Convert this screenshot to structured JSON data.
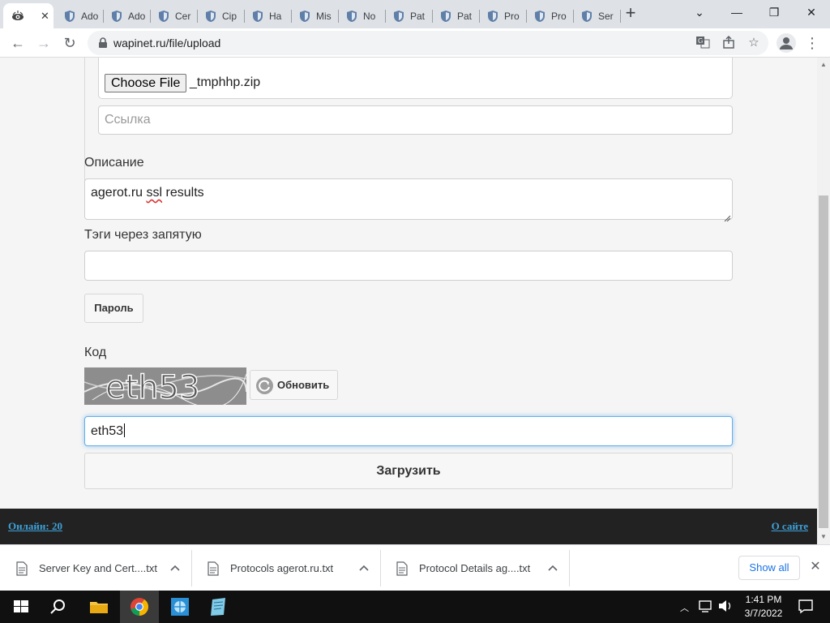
{
  "browser": {
    "tabs": [
      {
        "title": "",
        "icon": "eye-favicon",
        "active": true
      },
      {
        "title": "Ado",
        "icon": "shield-favicon"
      },
      {
        "title": "Ado",
        "icon": "shield-favicon"
      },
      {
        "title": "Cer",
        "icon": "shield-favicon"
      },
      {
        "title": "Cip",
        "icon": "shield-favicon"
      },
      {
        "title": "Ha",
        "icon": "shield-favicon"
      },
      {
        "title": "Mis",
        "icon": "shield-favicon"
      },
      {
        "title": "No",
        "icon": "shield-favicon"
      },
      {
        "title": "Pat",
        "icon": "shield-favicon"
      },
      {
        "title": "Pat",
        "icon": "shield-favicon"
      },
      {
        "title": "Pro",
        "icon": "shield-favicon"
      },
      {
        "title": "Pro",
        "icon": "shield-favicon"
      },
      {
        "title": "Ser",
        "icon": "shield-favicon"
      }
    ],
    "url": "wapinet.ru/file/upload"
  },
  "form": {
    "file_button": "Choose File",
    "file_name": "_tmphhp.zip",
    "link_placeholder": "Ссылка",
    "description_label": "Описание",
    "description_value_word1": "agerot.ru",
    "description_value_word2": "ssl",
    "description_value_word3": "results",
    "tags_label": "Тэги через запятую",
    "tags_value": "",
    "password_button": "Пароль",
    "code_label": "Код",
    "captcha_text": "eth53",
    "refresh_button": "Обновить",
    "code_value": "eth53",
    "upload_button": "Загрузить"
  },
  "footer": {
    "online": "Онлайн: 20",
    "about": "О сайте"
  },
  "downloads": {
    "items": [
      {
        "name": "Server Key and Cert....txt"
      },
      {
        "name": "Protocols agerot.ru.txt"
      },
      {
        "name": "Protocol Details ag....txt"
      }
    ],
    "show_all": "Show all"
  },
  "taskbar": {
    "time": "1:41 PM",
    "date": "3/7/2022"
  },
  "colors": {
    "footer_bg": "#222222",
    "footer_link": "#3da0d8",
    "focus_ring": "#66afe9",
    "page_bg": "#f5f5f5"
  }
}
